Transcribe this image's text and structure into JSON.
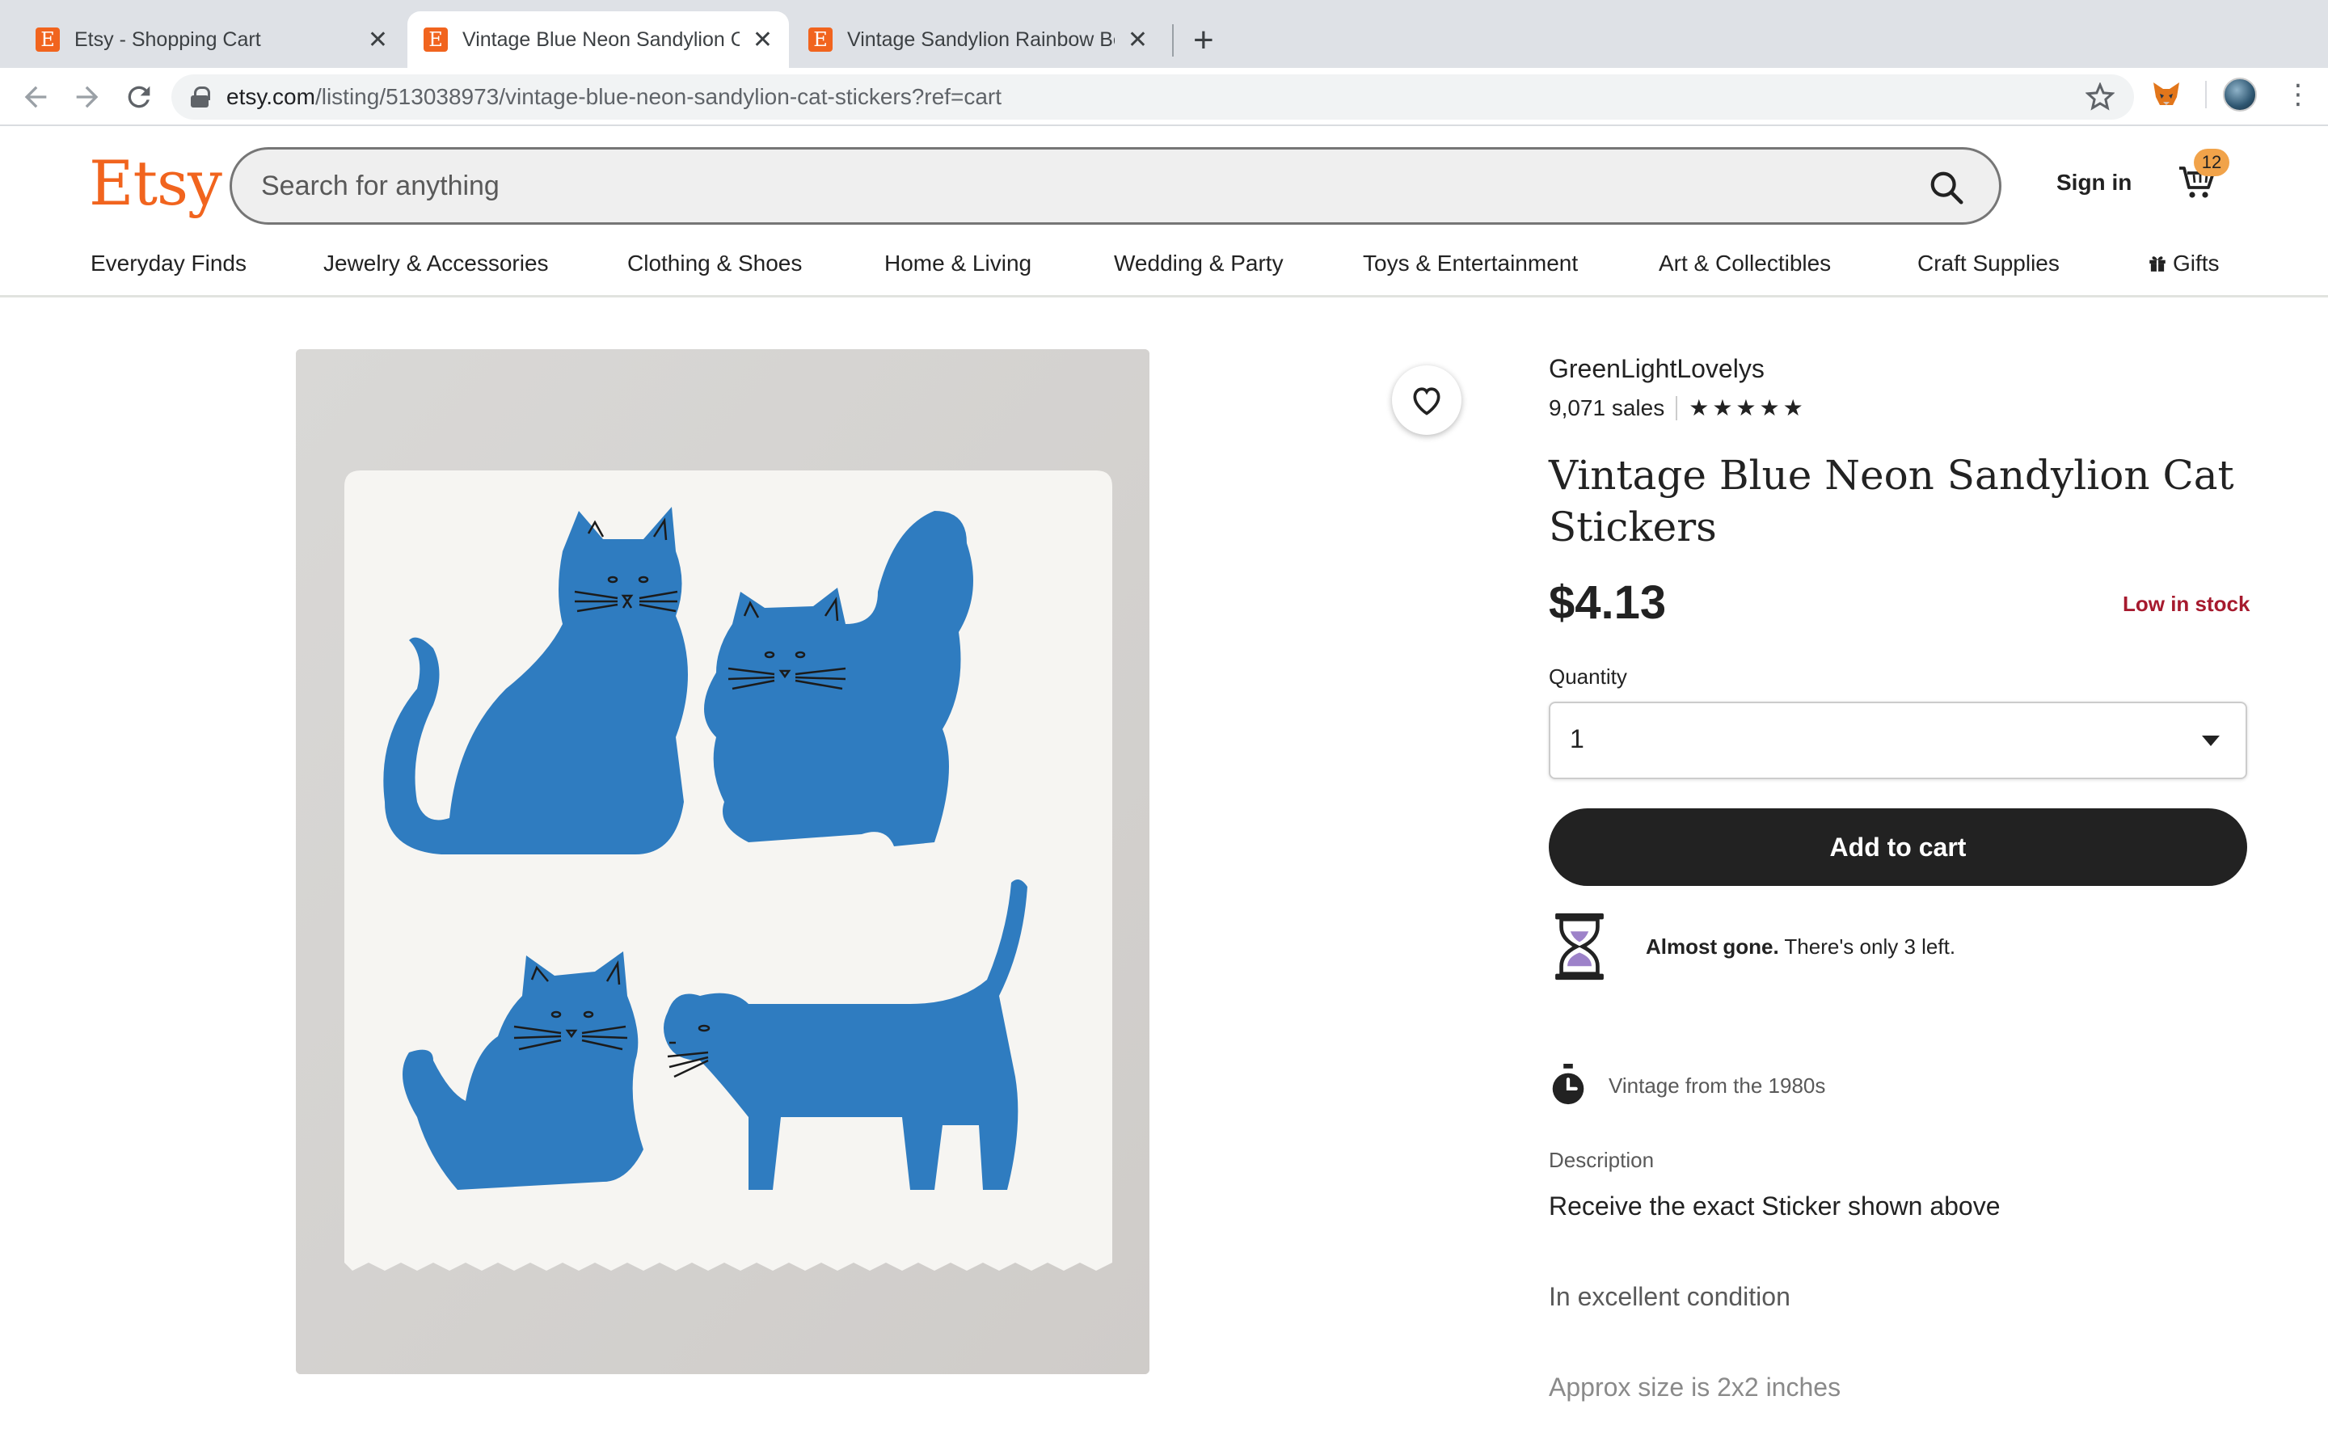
{
  "browser": {
    "tabs": [
      {
        "title": "Etsy - Shopping Cart",
        "favicon": "etsy-favicon",
        "active": false
      },
      {
        "title": "Vintage Blue Neon Sandylion C",
        "favicon": "etsy-favicon",
        "active": true
      },
      {
        "title": "Vintage Sandylion Rainbow Be",
        "favicon": "etsy-favicon",
        "active": false
      }
    ],
    "favicon_letter": "E",
    "close_glyph": "✕",
    "new_tab_glyph": "+",
    "url_host": "etsy.com",
    "url_path": "/listing/513038973/vintage-blue-neon-sandylion-cat-stickers?ref=cart",
    "nav_icons": [
      "back-arrow-icon",
      "forward-arrow-icon",
      "reload-icon",
      "lock-icon",
      "bookmark-star-icon",
      "metamask-fox-icon",
      "profile-avatar",
      "more-menu-icon"
    ]
  },
  "header": {
    "logo": "Etsy",
    "search_placeholder": "Search for anything",
    "sign_in": "Sign in",
    "cart_count": "12"
  },
  "categories": [
    "Everyday Finds",
    "Jewelry & Accessories",
    "Clothing & Shoes",
    "Home & Living",
    "Wedding & Party",
    "Toys & Entertainment",
    "Art & Collectibles",
    "Craft Supplies",
    "Gifts"
  ],
  "listing": {
    "shop_name": "GreenLightLovelys",
    "sales": "9,071 sales",
    "rating_stars": 5,
    "rating_glyphs": "★★★★★",
    "title": "Vintage Blue Neon Sandylion Cat Stickers",
    "price": "$4.13",
    "stock_status": "Low in stock",
    "quantity_label": "Quantity",
    "quantity_value": "1",
    "add_to_cart": "Add to cart",
    "almost_gone_bold": "Almost gone.",
    "almost_gone_rest": " There's only 3 left.",
    "vintage_note": "Vintage from the 1980s",
    "description_label": "Description",
    "description_lines": [
      "Receive the exact Sticker shown above",
      "In excellent condition",
      "Approx size is 2x2 inches"
    ]
  },
  "colors": {
    "etsy_orange": "#f1641e",
    "sticker_blue": "#2f7cc0",
    "low_stock_red": "#a61a2e",
    "cart_badge": "#f1a34a",
    "button_dark": "#222222"
  }
}
